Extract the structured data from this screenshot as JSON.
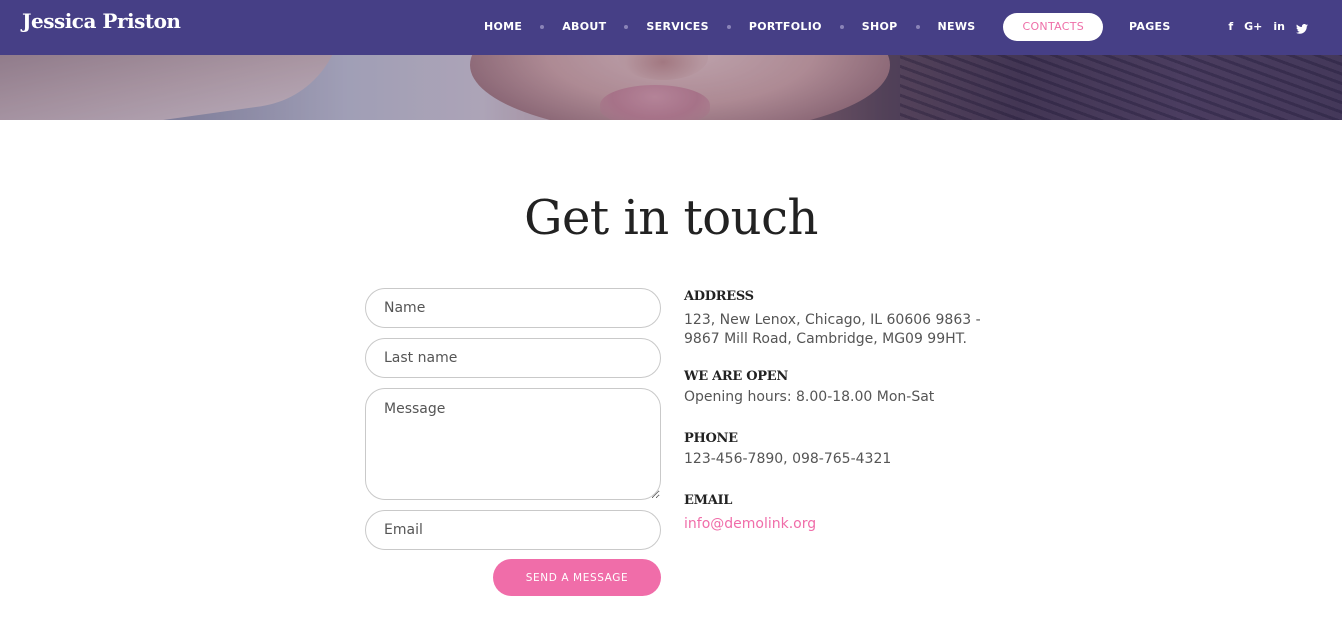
{
  "brand": {
    "name": "Jessica Priston"
  },
  "nav": {
    "items": [
      {
        "label": "HOME"
      },
      {
        "label": "ABOUT"
      },
      {
        "label": "SERVICES"
      },
      {
        "label": "PORTFOLIO"
      },
      {
        "label": "SHOP"
      },
      {
        "label": "NEWS"
      },
      {
        "label": "CONTACTS"
      },
      {
        "label": "PAGES"
      }
    ],
    "active": "CONTACTS"
  },
  "social": [
    {
      "icon": "facebook-icon",
      "glyph": "f"
    },
    {
      "icon": "google-plus-icon",
      "glyph": "G+"
    },
    {
      "icon": "linkedin-icon",
      "glyph": "in"
    },
    {
      "icon": "twitter-icon",
      "glyph": "🐦"
    }
  ],
  "page": {
    "title": "Get in touch"
  },
  "form": {
    "name_placeholder": "Name",
    "last_name_placeholder": "Last name",
    "message_placeholder": "Message",
    "email_placeholder": "Email",
    "submit_label": "SEND A MESSAGE"
  },
  "contact": {
    "address": {
      "heading": "ADDRESS",
      "text": "123, New Lenox, Chicago, IL 60606 9863 - 9867 Mill Road, Cambridge, MG09 99HT."
    },
    "hours": {
      "heading": "WE ARE OPEN",
      "text": "Opening hours: 8.00-18.00 Mon-Sat"
    },
    "phone": {
      "heading": "PHONE",
      "text": "123-456-7890, 098-765-4321"
    },
    "email": {
      "heading": "EMAIL",
      "text": "info@demolink.org"
    }
  },
  "colors": {
    "nav_background": "#463f86",
    "accent": "#f06da9",
    "heading_text": "#222222",
    "body_text": "#555555"
  }
}
